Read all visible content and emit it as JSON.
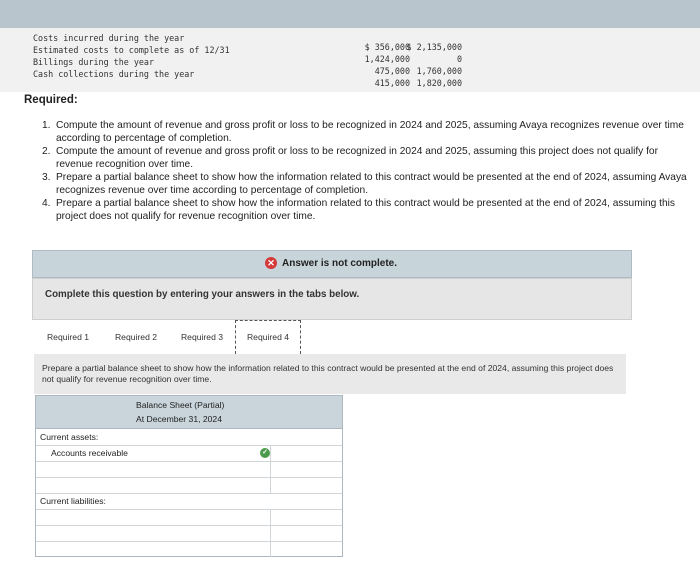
{
  "given": {
    "rows": [
      {
        "label": "Costs incurred during the year",
        "v2024": "$ 356,000",
        "v2025": "$ 2,135,000"
      },
      {
        "label": "Estimated costs to complete as of 12/31",
        "v2024": "1,424,000",
        "v2025": "0"
      },
      {
        "label": "Billings during the year",
        "v2024": "475,000",
        "v2025": "1,760,000"
      },
      {
        "label": "Cash collections during the year",
        "v2024": "415,000",
        "v2025": "1,820,000"
      }
    ]
  },
  "required": {
    "title": "Required:",
    "items": [
      {
        "num": "1.",
        "text": "Compute the amount of revenue and gross profit or loss to be recognized in 2024 and 2025, assuming Avaya recognizes revenue over time according to percentage of completion."
      },
      {
        "num": "2.",
        "text": "Compute the amount of revenue and gross profit or loss to be recognized in 2024 and 2025, assuming this project does not qualify for revenue recognition over time."
      },
      {
        "num": "3.",
        "text": "Prepare a partial balance sheet to show how the information related to this contract would be presented at the end of 2024, assuming Avaya recognizes revenue over time according to percentage of completion."
      },
      {
        "num": "4.",
        "text": "Prepare a partial balance sheet to show how the information related to this contract would be presented at the end of 2024, assuming this project does not qualify for revenue recognition over time."
      }
    ]
  },
  "status": {
    "text": "Answer is not complete."
  },
  "instructions": {
    "text": "Complete this question by entering your answers in the tabs below."
  },
  "tabs": [
    {
      "label": "Required 1"
    },
    {
      "label": "Required 2"
    },
    {
      "label": "Required 3"
    },
    {
      "label": "Required 4",
      "active": true
    }
  ],
  "panel": {
    "text": "Prepare a partial balance sheet to show how the information related to this contract would be presented at the end of 2024, assuming this project does not qualify for revenue recognition over time."
  },
  "sheet": {
    "title": "Balance Sheet (Partial)",
    "subtitle": "At December 31, 2024",
    "rows": [
      {
        "label": "Current assets:",
        "value": ""
      },
      {
        "label": "Accounts receivable",
        "value": ""
      },
      {
        "label": "",
        "value": ""
      },
      {
        "label": "",
        "value": ""
      },
      {
        "label": "Current liabilities:",
        "value": ""
      },
      {
        "label": "",
        "value": ""
      },
      {
        "label": "",
        "value": ""
      },
      {
        "label": "",
        "value": ""
      }
    ]
  },
  "colors": {
    "status_error": "#d43a3a",
    "status_ok": "#4c9a4c",
    "header_bg": "#c9d5db"
  }
}
